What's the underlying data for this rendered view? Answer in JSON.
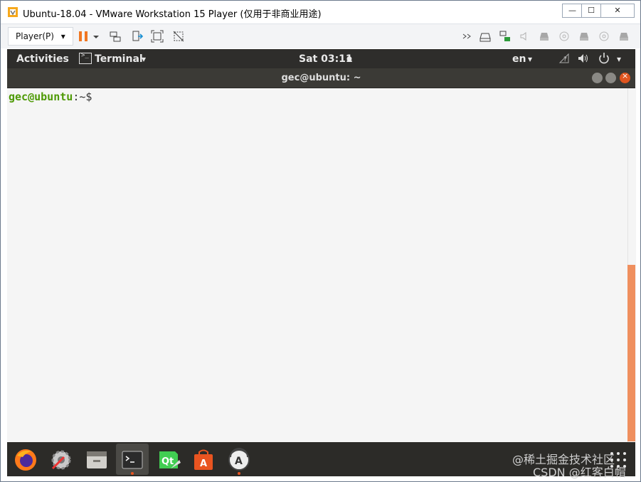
{
  "window": {
    "title": "Ubuntu-18.04 - VMware Workstation 15 Player (仅用于非商业用途)",
    "controls": {
      "minimize": "—",
      "maximize": "☐",
      "close": "✕"
    }
  },
  "toolbar": {
    "player_menu": "Player(P)",
    "player_caret": "▾",
    "icons": [
      "pause-icon",
      "send-ctrl-alt-del-icon",
      "removable-devices-icon",
      "fullscreen-icon",
      "unity-icon",
      "arrows-icon",
      "hdd-icon",
      "network-icon",
      "sound-icon",
      "printer-icon",
      "cd-icon",
      "usb-icon",
      "floppy-icon"
    ]
  },
  "ubuntu": {
    "topbar": {
      "activities": "Activities",
      "app_menu": "Terminal",
      "app_caret": "▾",
      "clock": "Sat 03:11",
      "clock_dot": "●",
      "lang": "en",
      "lang_caret": "▾",
      "power_caret": "▾"
    },
    "terminal": {
      "title": "gec@ubuntu: ~",
      "prompt_user": "gec@ubuntu",
      "prompt_path": ":~$ "
    },
    "dock": {
      "apps": [
        "firefox-icon",
        "settings-icon",
        "files-icon",
        "terminal-icon",
        "qt-creator-icon",
        "software-center-icon",
        "update-icon",
        "show-apps-icon"
      ]
    }
  },
  "watermark": {
    "line1": "@稀土掘金技术社区",
    "line2": "CSDN @红客白帽"
  },
  "colors": {
    "ubuntu_orange": "#e95420",
    "scrollbar": "#ef8f5e",
    "prompt_green": "#4e9a06",
    "topbar_bg": "#2e2d2b"
  }
}
